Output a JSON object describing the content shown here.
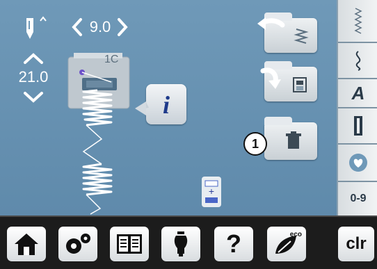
{
  "top": {
    "stitch_width": "9.0",
    "needle_label": ""
  },
  "left": {
    "stitch_length": "21.0"
  },
  "plate": {
    "label": "1C"
  },
  "callout": {
    "number": "1"
  },
  "sidebar": {
    "items": [
      {
        "icon": "zigzag-stitch-icon"
      },
      {
        "icon": "decorative-stitch-icon"
      },
      {
        "label": "A"
      },
      {
        "icon": "buttonhole-icon"
      },
      {
        "icon": "heart-icon"
      },
      {
        "label": "0-9"
      }
    ]
  },
  "bottom_bar": {
    "home_icon": "home-icon",
    "setup_icon": "gears-icon",
    "tutorial_icon": "book-icon",
    "consultant_icon": "dress-form-icon",
    "help_label": "?",
    "eco_label": "eco",
    "clr_label": "clr"
  },
  "colors": {
    "screen": "#6f99b8",
    "sidebar": "#eceff1",
    "bottom": "#1c1c1c"
  }
}
